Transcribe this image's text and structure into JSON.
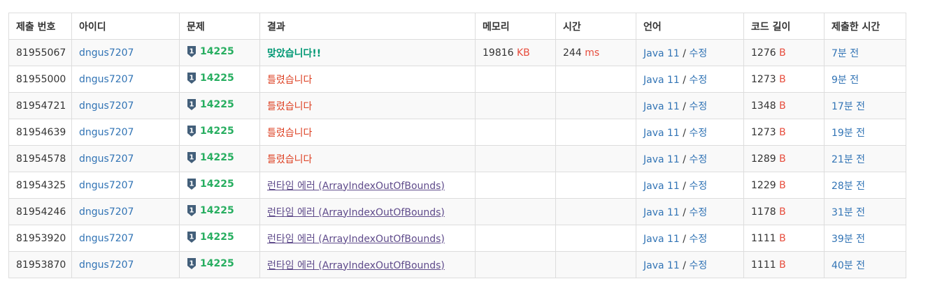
{
  "headers": [
    "제출 번호",
    "아이디",
    "문제",
    "결과",
    "메모리",
    "시간",
    "언어",
    "코드 길이",
    "제출한 시간"
  ],
  "lang_edit": "수정",
  "lang_sep": " / ",
  "tier_icon": "problem-tier-icon",
  "colors": {
    "link": "#3274b5",
    "problem": "#27ae60",
    "accepted": "#009874",
    "wrong": "#dd4124",
    "runtime_error": "#5f4b8b",
    "unit": "#e74c3c"
  },
  "rows": [
    {
      "id": "81955067",
      "user": "dngus7207",
      "problem": "14225",
      "result": "맞았습니다!!",
      "result_type": "ac",
      "memory": "19816",
      "memory_unit": "KB",
      "time": "244",
      "time_unit": "ms",
      "language": "Java 11",
      "code_length": "1276",
      "code_unit": "B",
      "submitted": "7분 전"
    },
    {
      "id": "81955000",
      "user": "dngus7207",
      "problem": "14225",
      "result": "틀렸습니다",
      "result_type": "wa",
      "memory": "",
      "memory_unit": "",
      "time": "",
      "time_unit": "",
      "language": "Java 11",
      "code_length": "1273",
      "code_unit": "B",
      "submitted": "9분 전"
    },
    {
      "id": "81954721",
      "user": "dngus7207",
      "problem": "14225",
      "result": "틀렸습니다",
      "result_type": "wa",
      "memory": "",
      "memory_unit": "",
      "time": "",
      "time_unit": "",
      "language": "Java 11",
      "code_length": "1348",
      "code_unit": "B",
      "submitted": "17분 전"
    },
    {
      "id": "81954639",
      "user": "dngus7207",
      "problem": "14225",
      "result": "틀렸습니다",
      "result_type": "wa",
      "memory": "",
      "memory_unit": "",
      "time": "",
      "time_unit": "",
      "language": "Java 11",
      "code_length": "1273",
      "code_unit": "B",
      "submitted": "19분 전"
    },
    {
      "id": "81954578",
      "user": "dngus7207",
      "problem": "14225",
      "result": "틀렸습니다",
      "result_type": "wa",
      "memory": "",
      "memory_unit": "",
      "time": "",
      "time_unit": "",
      "language": "Java 11",
      "code_length": "1289",
      "code_unit": "B",
      "submitted": "21분 전"
    },
    {
      "id": "81954325",
      "user": "dngus7207",
      "problem": "14225",
      "result": "런타임 에러 (ArrayIndexOutOfBounds)",
      "result_type": "rte",
      "memory": "",
      "memory_unit": "",
      "time": "",
      "time_unit": "",
      "language": "Java 11",
      "code_length": "1229",
      "code_unit": "B",
      "submitted": "28분 전"
    },
    {
      "id": "81954246",
      "user": "dngus7207",
      "problem": "14225",
      "result": "런타임 에러 (ArrayIndexOutOfBounds)",
      "result_type": "rte",
      "memory": "",
      "memory_unit": "",
      "time": "",
      "time_unit": "",
      "language": "Java 11",
      "code_length": "1178",
      "code_unit": "B",
      "submitted": "31분 전"
    },
    {
      "id": "81953920",
      "user": "dngus7207",
      "problem": "14225",
      "result": "런타임 에러 (ArrayIndexOutOfBounds)",
      "result_type": "rte",
      "memory": "",
      "memory_unit": "",
      "time": "",
      "time_unit": "",
      "language": "Java 11",
      "code_length": "1111",
      "code_unit": "B",
      "submitted": "39분 전"
    },
    {
      "id": "81953870",
      "user": "dngus7207",
      "problem": "14225",
      "result": "런타임 에러 (ArrayIndexOutOfBounds)",
      "result_type": "rte",
      "memory": "",
      "memory_unit": "",
      "time": "",
      "time_unit": "",
      "language": "Java 11",
      "code_length": "1111",
      "code_unit": "B",
      "submitted": "40분 전"
    }
  ]
}
